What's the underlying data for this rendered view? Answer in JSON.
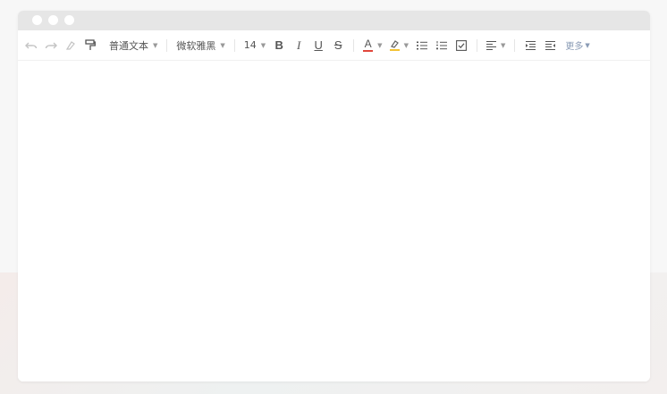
{
  "window": {
    "controls": [
      "dot",
      "dot",
      "dot"
    ]
  },
  "toolbar": {
    "undo_icon": "undo-icon",
    "redo_icon": "redo-icon",
    "clear_format_icon": "eraser-icon",
    "format_painter_icon": "paint-roller-icon",
    "paragraph_style": "普通文本",
    "font_family": "微软雅黑",
    "font_size": "14",
    "bold": "B",
    "italic": "I",
    "underline": "U",
    "strikethrough": "S",
    "font_color_label": "A",
    "font_color": "#e0463b",
    "highlight_color": "#f3c234",
    "bulleted_list_icon": "bulleted-list-icon",
    "numbered_list_icon": "numbered-list-icon",
    "checklist_icon": "checklist-icon",
    "align_icon": "align-left-icon",
    "indent_icon": "indent-icon",
    "outdent_icon": "outdent-icon",
    "more_label": "更多"
  },
  "editor": {
    "content": ""
  }
}
